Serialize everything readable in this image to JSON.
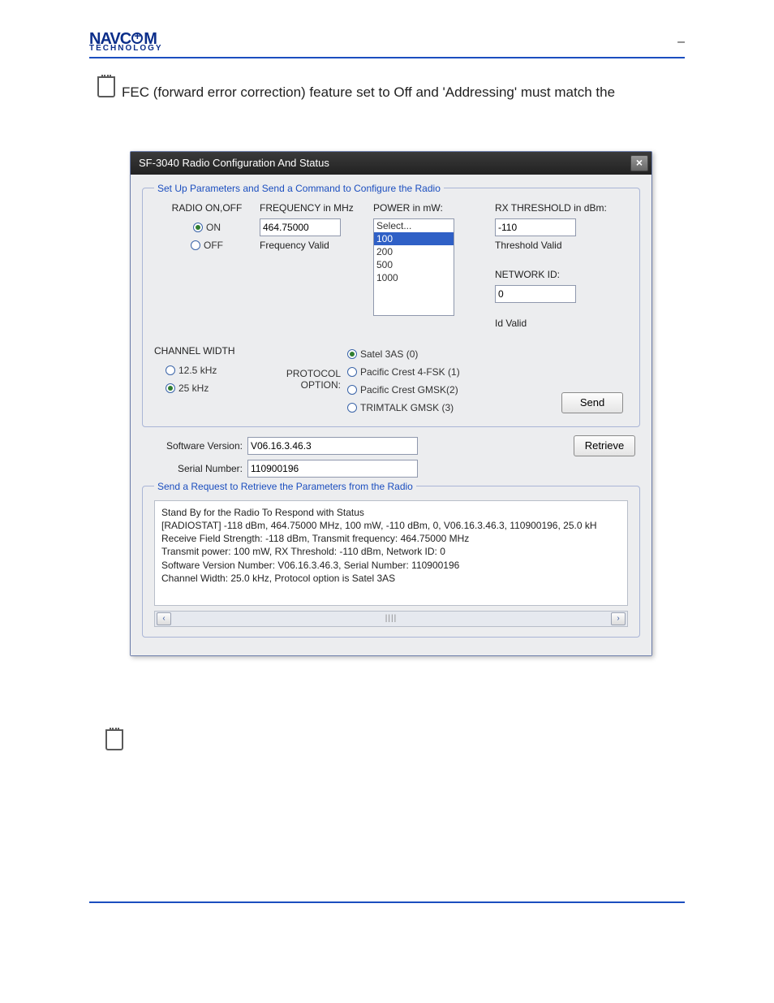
{
  "brand": {
    "line1": "NAVC",
    "line1b": "M",
    "line2": "TECHNOLOGY"
  },
  "intro": "FEC (forward error correction) feature set to Off and 'Addressing' must match the",
  "window_title": "SF-3040 Radio Configuration And Status",
  "group1_legend": "Set Up Parameters and Send a Command to Configure the Radio",
  "radio_hdr": "RADIO ON,OFF",
  "radio_on": "ON",
  "radio_off": "OFF",
  "freq_hdr": "FREQUENCY in MHz",
  "freq_value": "464.75000",
  "freq_status": "Frequency Valid",
  "power_hdr": "POWER in mW:",
  "power_options": [
    "Select...",
    "100",
    "200",
    "500",
    "1000"
  ],
  "power_selected": "100",
  "rx_hdr": "RX THRESHOLD in dBm:",
  "rx_value": "-110",
  "rx_status": "Threshold Valid",
  "net_hdr": "NETWORK ID:",
  "net_value": "0",
  "net_status": "Id Valid",
  "chw_hdr": "CHANNEL WIDTH",
  "chw_opt1": "12.5 kHz",
  "chw_opt2": "25 kHz",
  "proto_label": "PROTOCOL OPTION:",
  "proto_opts": [
    "Satel 3AS (0)",
    "Pacific Crest 4-FSK (1)",
    "Pacific Crest GMSK(2)",
    "TRIMTALK GMSK (3)"
  ],
  "send_btn": "Send",
  "sw_label": "Software Version:",
  "sw_value": "V06.16.3.46.3",
  "sn_label": "Serial Number:",
  "sn_value": "110900196",
  "retrieve_btn": "Retrieve",
  "group2_legend": "Send a Request to Retrieve the Parameters from the Radio",
  "log_lines": [
    "Stand By for the Radio To Respond with Status",
    "[RADIOSTAT] -118 dBm, 464.75000 MHz, 100 mW, -110 dBm, 0, V06.16.3.46.3, 110900196, 25.0 kH",
    "Receive Field Strength: -118 dBm, Transmit frequency: 464.75000 MHz",
    "Transmit power: 100 mW, RX Threshold: -110 dBm, Network ID: 0",
    "Software Version Number: V06.16.3.46.3, Serial Number: 110900196",
    "Channel Width: 25.0 kHz, Protocol option is Satel 3AS"
  ]
}
